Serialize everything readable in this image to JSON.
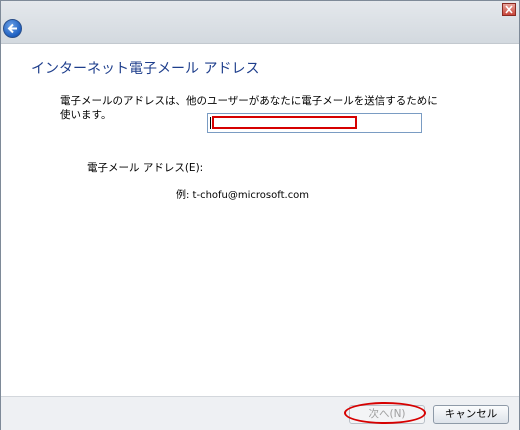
{
  "window": {
    "heading": "インターネット電子メール アドレス",
    "description": "電子メールのアドレスは、他のユーザーがあなたに電子メールを送信するために使います。"
  },
  "form": {
    "email_label": "電子メール アドレス(E):",
    "email_value": "",
    "example": "例: t-chofu@microsoft.com"
  },
  "buttons": {
    "next_label": "次へ(N)",
    "cancel_label": "キャンセル"
  },
  "icons": {
    "back": "back-arrow-icon",
    "close": "close-icon"
  },
  "colors": {
    "heading": "#1e3e8c",
    "annotation": "#d60000"
  }
}
